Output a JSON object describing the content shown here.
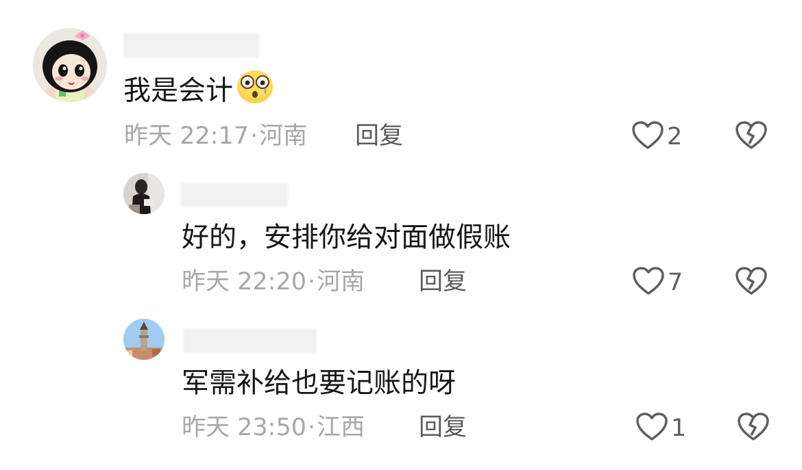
{
  "comments": [
    {
      "text": "我是会计",
      "emoji": "astonished-teary-face",
      "time": "昨天 22:17",
      "location": "河南",
      "reply_label": "回复",
      "likes": "2"
    },
    {
      "text": "好的，安排你给对面做假账",
      "time": "昨天 22:20",
      "location": "河南",
      "reply_label": "回复",
      "likes": "7"
    },
    {
      "text": "军需补给也要记账的呀",
      "time": "昨天 23:50",
      "location": "江西",
      "reply_label": "回复",
      "likes": "1"
    }
  ],
  "separator": "·",
  "icons": {
    "like": "heart-outline-icon",
    "dislike": "broken-heart-icon"
  },
  "colors": {
    "text": "#161616",
    "meta": "#a7a7a7",
    "icon": "#5e5e5e"
  }
}
